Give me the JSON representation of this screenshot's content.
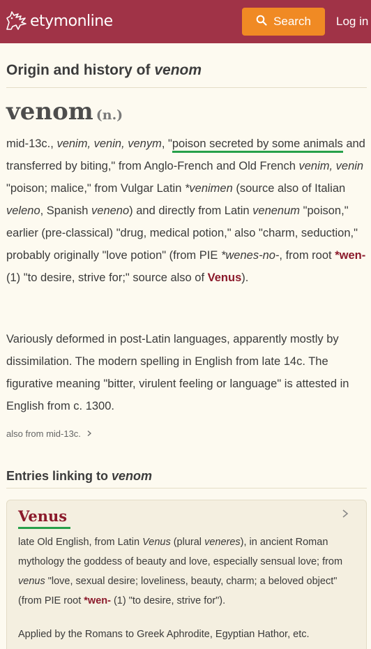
{
  "header": {
    "logo_text": "etymonline",
    "search_label": "Search",
    "login_label": "Log in",
    "colors": {
      "bar": "#a03347",
      "search": "#f08a24"
    }
  },
  "entry": {
    "heading_prefix": "Origin and history of ",
    "heading_word": "venom",
    "word": "venom",
    "pos": "(n.)",
    "p1": {
      "a": "mid-13c., ",
      "b": "venim, venin, venym",
      "c": ", \"",
      "d": "poison secreted by some animals",
      "e": " and transferred by biting,\" from Anglo-French and Old French ",
      "f": "venim, venin",
      "g": " \"poison; malice,\" from Vulgar Latin ",
      "h": "*venimen",
      "i": " (source also of Italian ",
      "j": "veleno",
      "k": ", Spanish ",
      "l": "veneno",
      "m": ") and directly from Latin ",
      "n": "venenum",
      "o": " \"poison,\" earlier (pre-classical) \"drug, medical potion,\" also \"charm, seduction,\" probably originally \"love potion\" (from PIE ",
      "p": "*wenes-no-",
      "q": ", from root ",
      "r": "*wen-",
      "s": " (1) \"to desire, strive for;\" source also of ",
      "t": "Venus",
      "u": ")."
    },
    "p2": "Variously deformed in post-Latin languages, apparently mostly by dissimilation. The modern spelling in English from late 14c. The figurative meaning \"bitter, virulent feeling or language\" is attested in English from c. 1300.",
    "also_from": "also from mid-13c."
  },
  "linking": {
    "title_prefix": "Entries linking to ",
    "title_word": "venom",
    "card": {
      "title": "Venus",
      "p1": {
        "a": "late Old English, from Latin ",
        "b": "Venus",
        "c": " (plural ",
        "d": "veneres",
        "e": "), in ancient Roman mythology the goddess of beauty and love, especially sensual love; from ",
        "f": "venus",
        "g": " \"love, sexual desire; loveliness, beauty, charm; a beloved object\" (from PIE root ",
        "h": "*wen-",
        "i": " (1) \"to desire, strive for\")."
      },
      "p2": "Applied by the Romans to Greek Aphrodite, Egyptian Hathor, etc."
    }
  },
  "icons": {
    "logo": "griffin-logo-icon",
    "search": "search-icon",
    "also_chevron": "chevron-right-icon",
    "card_chevron": "chevron-right-icon"
  }
}
